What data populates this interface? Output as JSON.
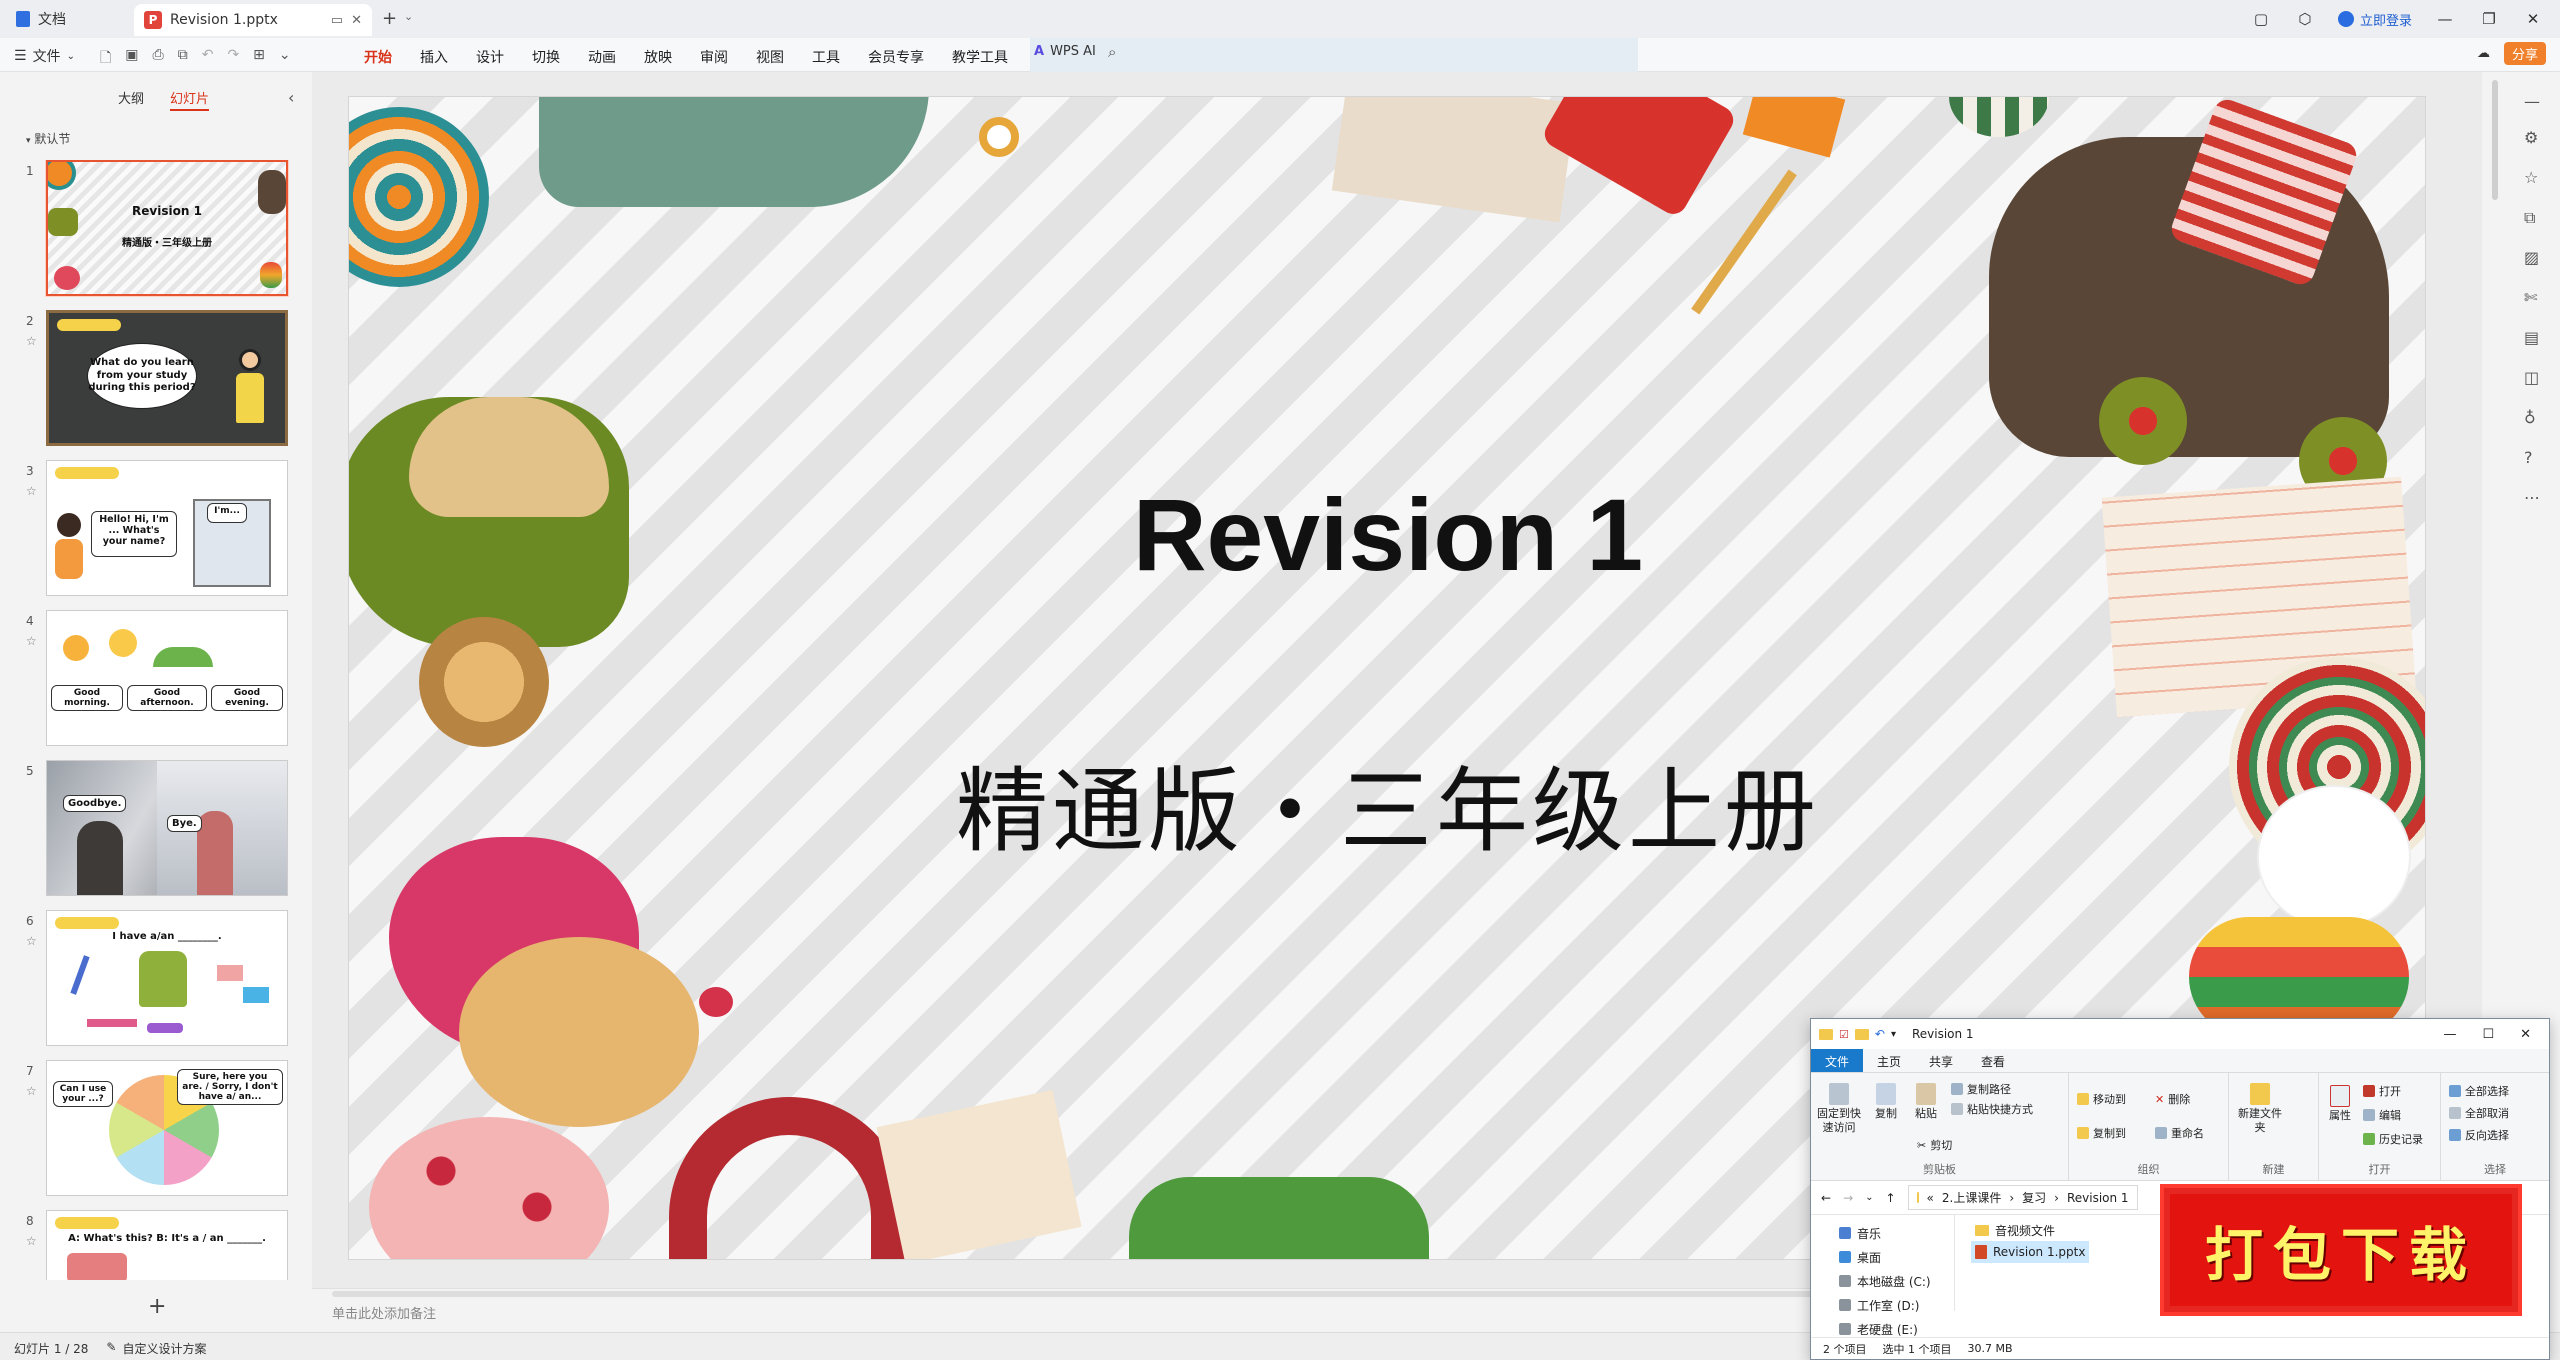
{
  "titlebar": {
    "home_tab": "文档",
    "doc_tab": "Revision 1.pptx",
    "login": "立即登录"
  },
  "menubar": {
    "file_menu": "文件",
    "ribbon_tabs": [
      "开始",
      "插入",
      "设计",
      "切换",
      "动画",
      "放映",
      "审阅",
      "视图",
      "工具",
      "会员专享",
      "教学工具"
    ],
    "active_tab": "开始",
    "wps_ai": "WPS AI",
    "share": "分享"
  },
  "leftpanel": {
    "tabs": [
      "大纲",
      "幻灯片"
    ],
    "active_tab": "幻灯片",
    "section": "默认节",
    "slides": [
      {
        "num": "1",
        "line1": "Revision 1",
        "line2": "精通版・三年级上册"
      },
      {
        "num": "2",
        "bubble": "What do you learn from your study during this period?"
      },
      {
        "num": "3",
        "bubble1": "Hello! Hi, I'm ... What's your name?",
        "bubble2": "I'm..."
      },
      {
        "num": "4",
        "labels": [
          "Good morning.",
          "Good afternoon.",
          "Good evening."
        ]
      },
      {
        "num": "5",
        "bubble1": "Goodbye.",
        "bubble2": "Bye."
      },
      {
        "num": "6",
        "prompt": "I have a/an ________."
      },
      {
        "num": "7",
        "bubble1": "Can I use your ...?",
        "bubble2": "Sure, here you are. / Sorry, I don't have a/ an..."
      },
      {
        "num": "8",
        "prompt": "A: What's this? B: It's a / an _______."
      }
    ]
  },
  "slide": {
    "title": "Revision 1",
    "subtitle": "精通版・三年级上册"
  },
  "notes": {
    "placeholder": "单击此处添加备注"
  },
  "statusbar": {
    "slide_counter": "幻灯片 1 / 28",
    "design": "自定义设计方案"
  },
  "explorer": {
    "title": "Revision 1",
    "tabs": [
      "文件",
      "主页",
      "共享",
      "查看"
    ],
    "active_tab": "文件",
    "clipboard": {
      "pin": "固定到快速访问",
      "copy": "复制",
      "paste": "粘贴",
      "copy_path": "复制路径",
      "paste_shortcut": "粘贴快捷方式",
      "cut": "剪切",
      "label": "剪贴板"
    },
    "organize": {
      "move_to": "移动到",
      "copy_to": "复制到",
      "delete": "删除",
      "rename": "重命名",
      "label": "组织"
    },
    "new": {
      "new_folder": "新建文件夹",
      "label": "新建"
    },
    "open": {
      "properties": "属性",
      "open": "打开",
      "edit": "编辑",
      "history": "历史记录",
      "label": "打开"
    },
    "select": {
      "all": "全部选择",
      "none": "全部取消",
      "invert": "反向选择",
      "label": "选择"
    },
    "breadcrumb": [
      "«",
      "2.上课课件",
      "复习",
      "Revision 1"
    ],
    "nav": [
      "音乐",
      "桌面",
      "本地磁盘 (C:)",
      "工作室 (D:)",
      "老硬盘 (E:)"
    ],
    "files": [
      {
        "name": "音视频文件",
        "type": "folder",
        "selected": false
      },
      {
        "name": "Revision 1.pptx",
        "type": "pptx",
        "selected": true
      }
    ],
    "status": {
      "count": "2 个项目",
      "selected": "选中 1 个项目",
      "size": "30.7 MB"
    }
  },
  "promo": {
    "text": "打包下载"
  },
  "colors": {
    "accent": "#d9331a",
    "explorer_accent": "#1979ca",
    "promo_bg": "#e3140f",
    "promo_text": "#fff36a"
  }
}
